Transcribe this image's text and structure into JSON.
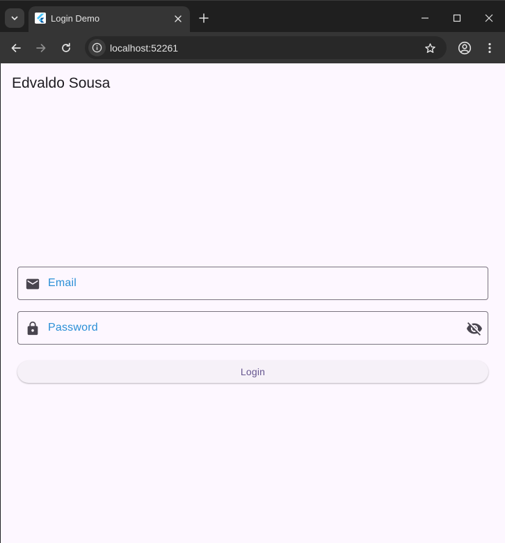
{
  "browser": {
    "tab": {
      "title": "Login Demo",
      "favicon": "flutter-icon"
    },
    "address_bar": {
      "url": "localhost:52261"
    },
    "colors": {
      "tabstrip_bg": "#1f1f1f",
      "toolbar_bg": "#353535",
      "omnibox_bg": "#282828"
    }
  },
  "app": {
    "title": "Edvaldo Sousa",
    "email_field": {
      "label": "Email",
      "icon": "mail-icon"
    },
    "password_field": {
      "label": "Password",
      "icon": "lock-icon",
      "trailing_icon": "visibility-off-icon"
    },
    "login_button": {
      "label": "Login"
    },
    "colors": {
      "background": "#fdf7ff",
      "label": "#2a8fd6",
      "button_text": "#65558f",
      "outline": "#79747e"
    }
  }
}
